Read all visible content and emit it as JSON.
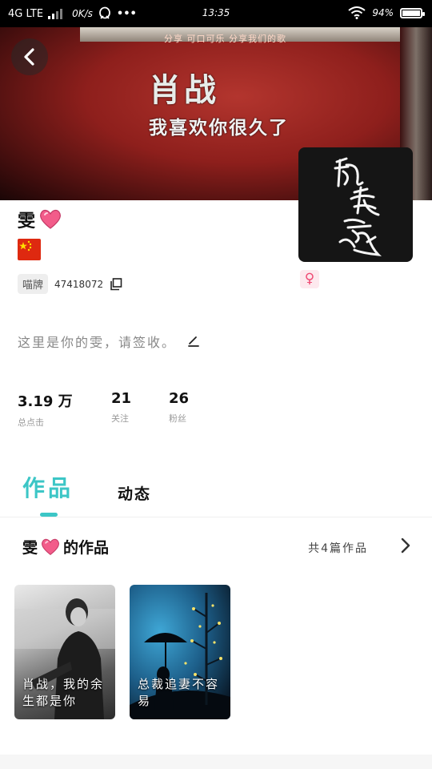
{
  "status_bar": {
    "network": "4G LTE",
    "speed": "0K/s",
    "more": "•••",
    "time": "13:35",
    "battery": "94"
  },
  "cover": {
    "brand_text": "分享 可口可乐 分享我们的歌",
    "headline": "肖战",
    "subline": "我喜欢你很久了"
  },
  "avatar": {
    "art_text": "貌无言逆"
  },
  "profile": {
    "nickname": "雯",
    "gender_symbol": "♀",
    "id_tag": "喵牌",
    "id_number": "47418072",
    "signature": "这里是你的雯，请签收。"
  },
  "stats": [
    {
      "value": "3.19 万",
      "label": "总点击"
    },
    {
      "value": "21",
      "label": "关注"
    },
    {
      "value": "26",
      "label": "粉丝"
    }
  ],
  "tabs": {
    "active": "作品",
    "inactive": "动态"
  },
  "works": {
    "owner": "雯",
    "header_suffix": "的作品",
    "count_text": "共4篇作品",
    "items": [
      {
        "title": "肖战，我的余生都是你"
      },
      {
        "title": "总裁追妻不容易"
      }
    ]
  },
  "colors": {
    "accent": "#3cc6c6",
    "heart": "#f25c8a",
    "gender": "#ef4a73"
  }
}
